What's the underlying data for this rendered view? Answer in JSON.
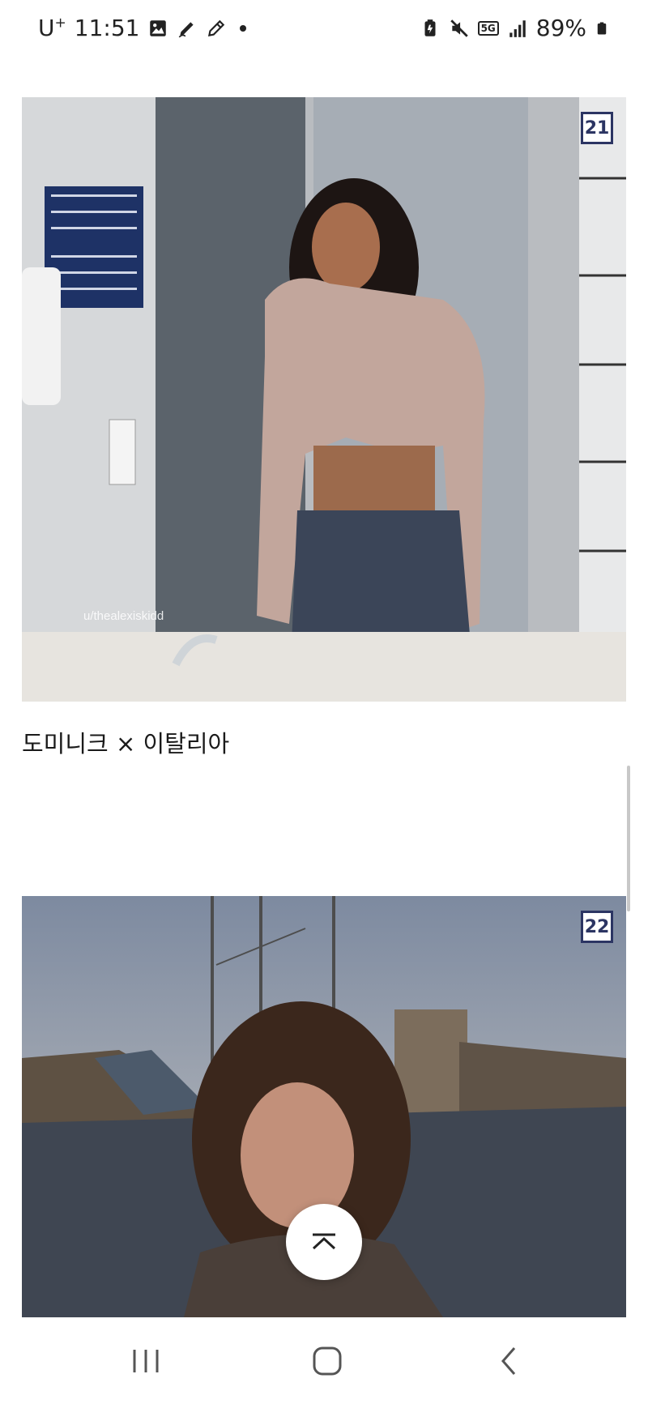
{
  "status_bar": {
    "carrier": "U",
    "carrier_sup": "+",
    "time": "11:51",
    "network": "5G",
    "battery": "89%",
    "icons_left": [
      "gallery-icon",
      "pen-icon",
      "edit-icon",
      "notification-dot-icon"
    ],
    "icons_right": [
      "battery-saver-icon",
      "mute-icon",
      "network-5g-icon",
      "signal-icon",
      "battery-icon"
    ]
  },
  "feed": {
    "items": [
      {
        "rank": "21",
        "watermark": "u/thealexiskidd",
        "caption": "도미니크 × 이탈리아"
      },
      {
        "rank": "22"
      }
    ]
  },
  "scroll_top": {
    "icon": "chevron-up-icon"
  },
  "nav_bar": {
    "icons": [
      "recent-apps-icon",
      "home-icon",
      "back-icon"
    ]
  },
  "colors": {
    "badge_border": "#2c3563",
    "background": "#ffffff"
  }
}
